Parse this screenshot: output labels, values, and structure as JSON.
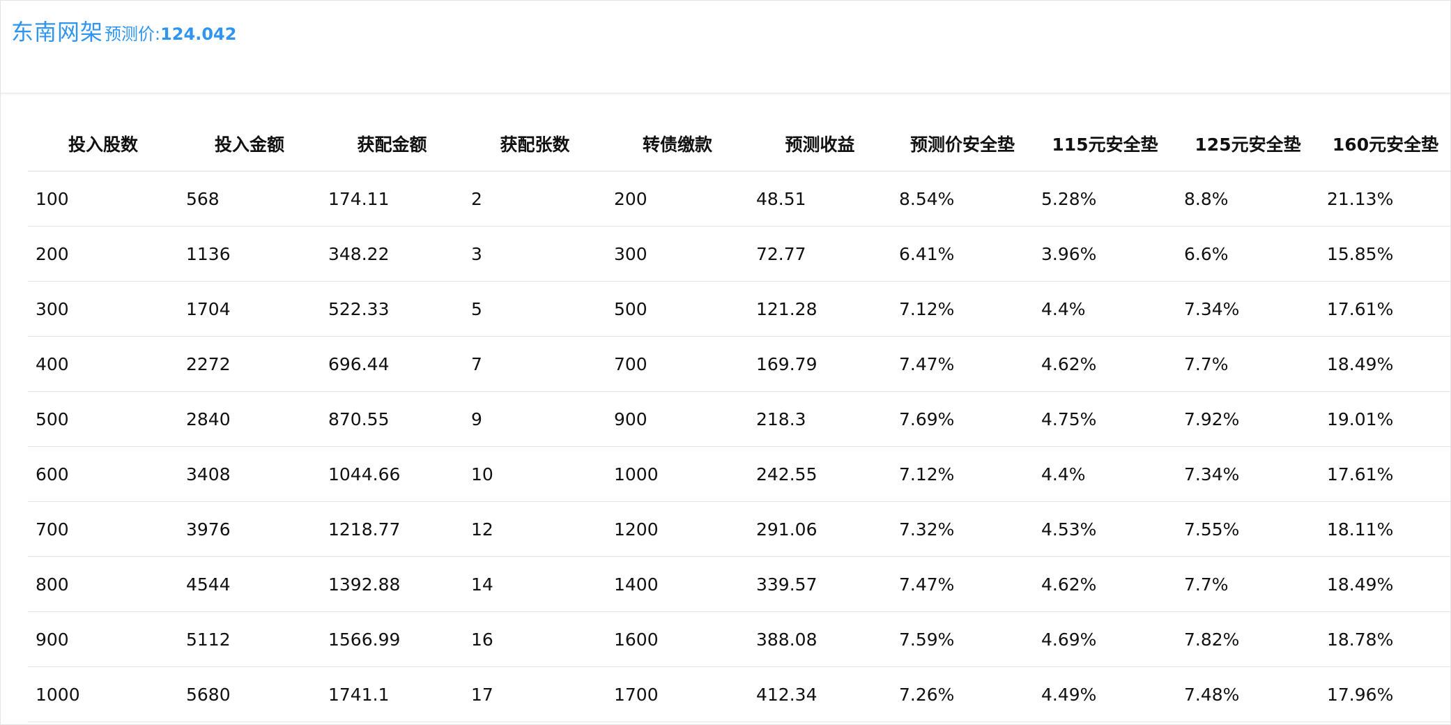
{
  "title": {
    "name": "东南网架",
    "price_label": "预测价:",
    "price_value": "124.042"
  },
  "table": {
    "headers": [
      "投入股数",
      "投入金额",
      "获配金额",
      "获配张数",
      "转债缴款",
      "预测收益",
      "预测价安全垫",
      "115元安全垫",
      "125元安全垫",
      "160元安全垫"
    ],
    "rows": [
      [
        "100",
        "568",
        "174.11",
        "2",
        "200",
        "48.51",
        "8.54%",
        "5.28%",
        "8.8%",
        "21.13%"
      ],
      [
        "200",
        "1136",
        "348.22",
        "3",
        "300",
        "72.77",
        "6.41%",
        "3.96%",
        "6.6%",
        "15.85%"
      ],
      [
        "300",
        "1704",
        "522.33",
        "5",
        "500",
        "121.28",
        "7.12%",
        "4.4%",
        "7.34%",
        "17.61%"
      ],
      [
        "400",
        "2272",
        "696.44",
        "7",
        "700",
        "169.79",
        "7.47%",
        "4.62%",
        "7.7%",
        "18.49%"
      ],
      [
        "500",
        "2840",
        "870.55",
        "9",
        "900",
        "218.3",
        "7.69%",
        "4.75%",
        "7.92%",
        "19.01%"
      ],
      [
        "600",
        "3408",
        "1044.66",
        "10",
        "1000",
        "242.55",
        "7.12%",
        "4.4%",
        "7.34%",
        "17.61%"
      ],
      [
        "700",
        "3976",
        "1218.77",
        "12",
        "1200",
        "291.06",
        "7.32%",
        "4.53%",
        "7.55%",
        "18.11%"
      ],
      [
        "800",
        "4544",
        "1392.88",
        "14",
        "1400",
        "339.57",
        "7.47%",
        "4.62%",
        "7.7%",
        "18.49%"
      ],
      [
        "900",
        "5112",
        "1566.99",
        "16",
        "1600",
        "388.08",
        "7.59%",
        "4.69%",
        "7.82%",
        "18.78%"
      ],
      [
        "1000",
        "5680",
        "1741.1",
        "17",
        "1700",
        "412.34",
        "7.26%",
        "4.49%",
        "7.48%",
        "17.96%"
      ]
    ]
  },
  "colors": {
    "accent": "#2f95f0",
    "text": "#111111",
    "border": "#e1e4ea"
  }
}
